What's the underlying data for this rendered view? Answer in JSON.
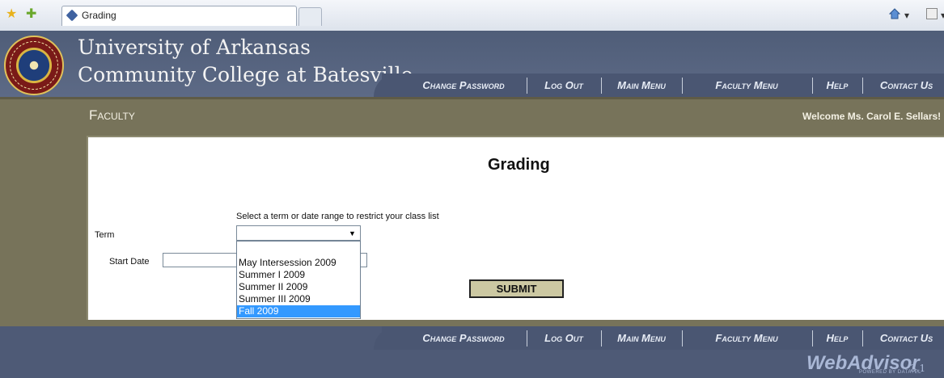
{
  "browser": {
    "tab_title": "Grading",
    "toolbar": {
      "page_label": "Page ▾",
      "home_dropdown": "▾",
      "feeds_dropdown": "▾",
      "print_dropdown": "▾"
    }
  },
  "header": {
    "college_line1": "University of Arkansas",
    "college_line2": "Community College at Batesville"
  },
  "nav": {
    "items": [
      {
        "label": "Change Password"
      },
      {
        "label": "Log Out"
      },
      {
        "label": "Main Menu"
      },
      {
        "label": "Faculty Menu"
      },
      {
        "label": "Help"
      },
      {
        "label": "Contact Us"
      }
    ]
  },
  "band": {
    "section_title": "Faculty",
    "welcome": "Welcome Ms. Carol E. Sellars!"
  },
  "main": {
    "title": "Grading",
    "instructions": "Select a term or date range to restrict your class list",
    "term_label": "Term",
    "term_value": "",
    "start_date_label": "Start Date",
    "start_date_value": "",
    "term_options": [
      {
        "label": ""
      },
      {
        "label": "May Intersession 2009"
      },
      {
        "label": "Summer I 2009"
      },
      {
        "label": "Summer II 2009"
      },
      {
        "label": "Summer III 2009"
      },
      {
        "label": "Fall 2009"
      }
    ],
    "highlighted_option": "Fall 2009",
    "submit_label": "SUBMIT"
  },
  "footer": {
    "brand_web": "WebAdvisor",
    "brand_version": "3.1",
    "powered_by": "POWERED BY DATATEL"
  },
  "colors": {
    "header_bg": "#4f5d78",
    "band_bg": "#77735a",
    "submit_bg": "#ccc8a2",
    "highlight": "#3399ff"
  }
}
